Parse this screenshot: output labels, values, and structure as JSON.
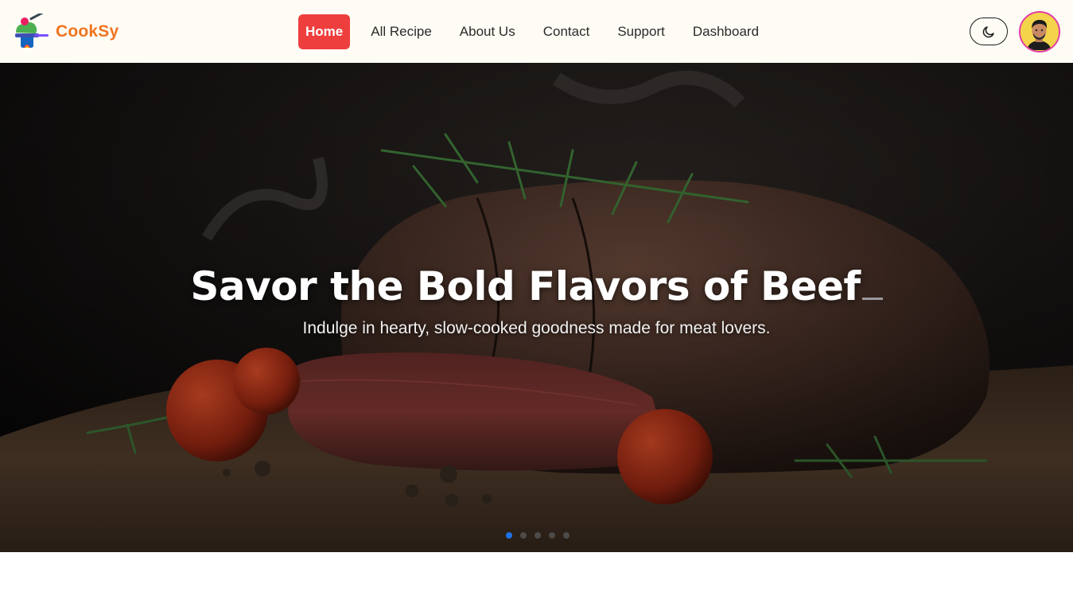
{
  "brand": {
    "name": "CookSy"
  },
  "nav": {
    "items": [
      {
        "label": "Home",
        "active": true
      },
      {
        "label": "All Recipe",
        "active": false
      },
      {
        "label": "About Us",
        "active": false
      },
      {
        "label": "Contact",
        "active": false
      },
      {
        "label": "Support",
        "active": false
      },
      {
        "label": "Dashboard",
        "active": false
      }
    ]
  },
  "header_actions": {
    "theme_icon": "moon-icon",
    "avatar_icon": "user-avatar"
  },
  "hero": {
    "title": "Savor the Bold Flavors of Beef",
    "subtitle": "Indulge in hearty, slow-cooked goodness made for meat lovers.",
    "slides": {
      "count": 5,
      "active_index": 0
    }
  },
  "colors": {
    "accent": "#ee3e3e",
    "brand": "#f0741f",
    "nav_background": "#fffcf5",
    "avatar_ring": "#e23ca4",
    "active_dot": "#1e73e8"
  }
}
